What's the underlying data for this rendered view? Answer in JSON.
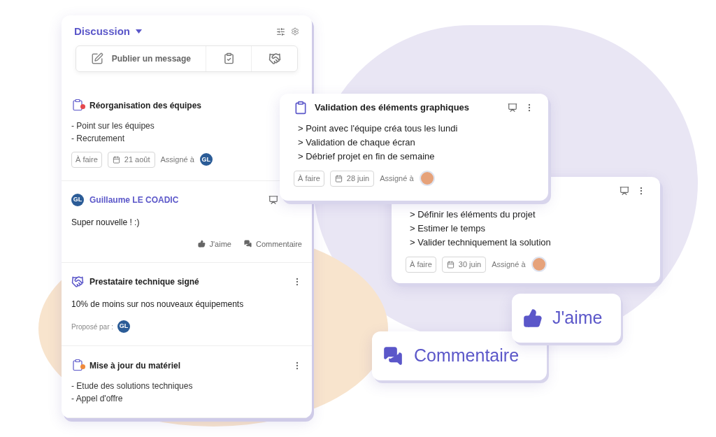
{
  "panel": {
    "title": "Discussion",
    "composer_label": "Publier un message",
    "feed": [
      {
        "kind": "task",
        "color": "#e5484d",
        "title": "Réorganisation des équipes",
        "lines": [
          "- Point sur les équipes",
          "- Recrutement"
        ],
        "status": "À faire",
        "date": "21 août",
        "assignee_label": "Assigné à",
        "assignee_initials": "GL"
      },
      {
        "kind": "message",
        "author_initials": "GL",
        "author": "Guillaume LE COADIC",
        "text": "Super nouvelle ! :)",
        "like": "J'aime",
        "comment": "Commentaire"
      },
      {
        "kind": "deal",
        "title": "Prestataire technique signé",
        "text": "10% de moins sur nos nouveaux équipements",
        "proposer_label": "Proposé par :",
        "proposer_initials": "GL"
      },
      {
        "kind": "task",
        "color": "#f08a3c",
        "title": "Mise à jour du matériel",
        "lines": [
          "- Etude des solutions techniques",
          "- Appel d'offre"
        ]
      }
    ]
  },
  "cards": [
    {
      "title": "Validation des éléments graphiques",
      "lines": [
        "> Point avec l'équipe créa tous les lundi",
        "> Validation de chaque écran",
        "> Débrief projet en fin de semaine"
      ],
      "status": "À faire",
      "date": "28 juin",
      "assignee_label": "Assigné à"
    },
    {
      "lines": [
        "> Définir les éléments du projet",
        "> Estimer le temps",
        "> Valider techniquement la solution"
      ],
      "status": "À faire",
      "date": "30 juin",
      "assignee_label": "Assigné à"
    }
  ],
  "like_button": "J'aime",
  "comment_button": "Commentaire"
}
